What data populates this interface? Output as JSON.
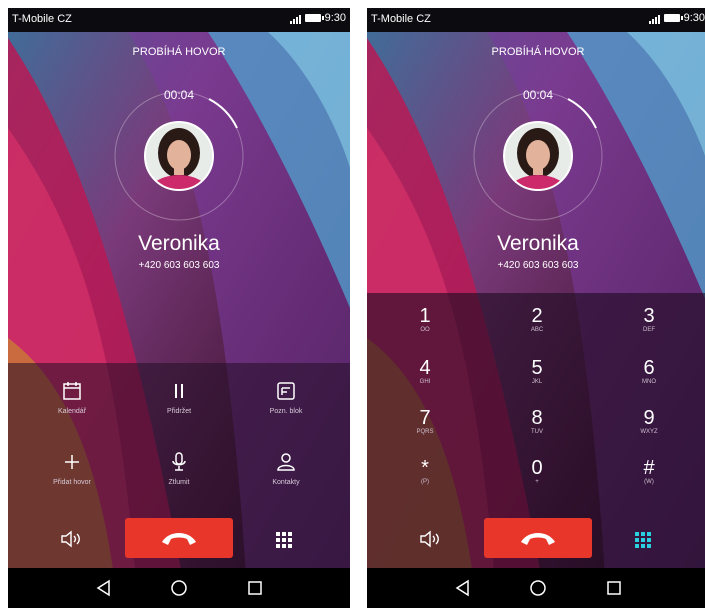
{
  "left": {
    "status": {
      "carrier": "T-Mobile CZ",
      "time": "9:30"
    },
    "call_state": "PROBÍHÁ HOVOR",
    "timer": "00:04",
    "contact": {
      "name": "Veronika",
      "number": "+420 603 603 603"
    },
    "actions": [
      {
        "label": "Kalendář",
        "icon": "calendar-icon"
      },
      {
        "label": "Přidržet",
        "icon": "pause-icon"
      },
      {
        "label": "Pozn. blok",
        "icon": "notepad-icon"
      },
      {
        "label": "Přidat hovor",
        "icon": "plus-icon"
      },
      {
        "label": "Ztlumit",
        "icon": "microphone-icon"
      },
      {
        "label": "Kontakty",
        "icon": "person-icon"
      }
    ]
  },
  "right": {
    "status": {
      "carrier": "T-Mobile CZ",
      "time": "9:30"
    },
    "call_state": "PROBÍHÁ HOVOR",
    "timer": "00:04",
    "contact": {
      "name": "Veronika",
      "number": "+420 603 603 603"
    },
    "keys": [
      {
        "digit": "1",
        "letters": "OO"
      },
      {
        "digit": "2",
        "letters": "ABC"
      },
      {
        "digit": "3",
        "letters": "DEF"
      },
      {
        "digit": "4",
        "letters": "GHI"
      },
      {
        "digit": "5",
        "letters": "JKL"
      },
      {
        "digit": "6",
        "letters": "MNO"
      },
      {
        "digit": "7",
        "letters": "PQRS"
      },
      {
        "digit": "8",
        "letters": "TUV"
      },
      {
        "digit": "9",
        "letters": "WXYZ"
      },
      {
        "digit": "*",
        "letters": "(P)"
      },
      {
        "digit": "0",
        "letters": "+"
      },
      {
        "digit": "#",
        "letters": "(W)"
      }
    ]
  },
  "colors": {
    "end_call": "#e9362b",
    "dialpad_active": "#2ad0e0",
    "wallpaper_pink": "#c2185b",
    "wallpaper_blue": "#5aa9d6"
  },
  "icons": {
    "speaker": "speaker-icon",
    "end_call": "end-call-icon",
    "dialpad": "dialpad-icon",
    "back": "back-icon",
    "home": "home-icon",
    "recents": "recents-icon"
  }
}
